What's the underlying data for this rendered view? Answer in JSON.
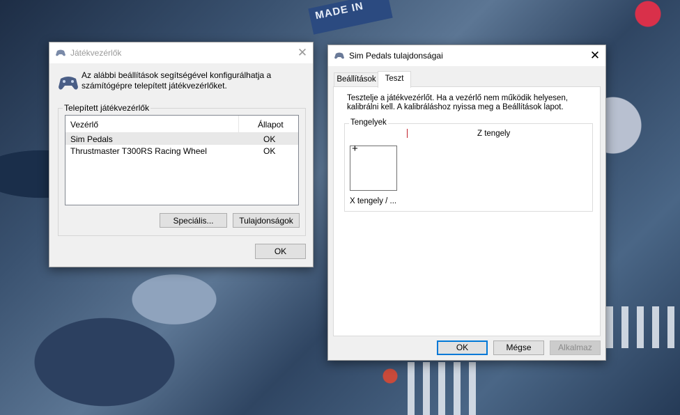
{
  "background": {
    "sign_text": "MADE IN"
  },
  "game_controllers": {
    "title": "Játékvezérlők",
    "close_label": "✕",
    "description": "Az alábbi beállítások segítségével konfigurálhatja a számítógépre telepített játékvezérlőket.",
    "group_label": "Telepített játékvezérlők",
    "columns": [
      "Vezérlő",
      "Állapot"
    ],
    "rows": [
      {
        "name": "Sim Pedals",
        "status": "OK"
      },
      {
        "name": "Thrustmaster T300RS Racing Wheel",
        "status": "OK"
      }
    ],
    "advanced_button": "Speciális...",
    "properties_button": "Tulajdonságok",
    "ok_button": "OK"
  },
  "properties": {
    "title": "Sim Pedals tulajdonságai",
    "close_label": "✕",
    "tabs": [
      {
        "label": "Beállítások",
        "active": false
      },
      {
        "label": "Teszt",
        "active": true
      }
    ],
    "instructions": "Tesztelje a játékvezérlőt. Ha a vezérlő nem működik helyesen, kalibrálni kell. A kalibráláshoz nyissa meg a Beállítások lapot.",
    "axes_group_label": "Tengelyek",
    "z_axis_label": "Z tengely",
    "xy_axis_label": "X tengely / ...",
    "crosshair": "+",
    "ok_button": "OK",
    "cancel_button": "Mégse",
    "apply_button": "Alkalmaz"
  },
  "colors": {
    "accent": "#0078d7",
    "selected_row": "#e8e8e8",
    "z_indicator": "#c0202a"
  }
}
